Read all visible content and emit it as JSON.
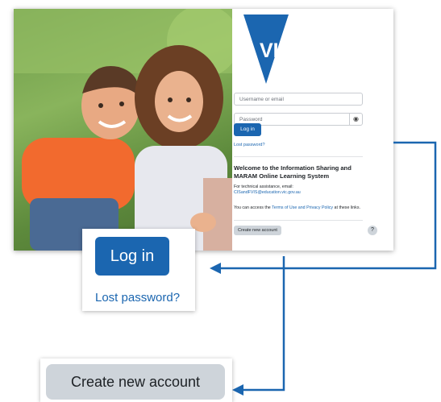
{
  "brand": {
    "logo_text": "VICTORIA",
    "color": "#1b66b0"
  },
  "login": {
    "username_placeholder": "Username or email",
    "password_placeholder": "Password",
    "login_label": "Log in",
    "lost_password": "Lost password?",
    "show_password_icon": "eye-icon"
  },
  "info": {
    "welcome": "Welcome to the Information Sharing and MARAM Online Learning System",
    "assist_prefix": "For technical assistance, email:",
    "assist_email": "CISandFVIS@education.vic.gov.au",
    "terms_prefix": "You can access the ",
    "terms_link": "Terms of Use and Privacy Policy",
    "terms_suffix": " at these links.",
    "create_account": "Create new account",
    "help": "?"
  },
  "callouts": {
    "login_label": "Log in",
    "lost_password": "Lost password?",
    "create_account": "Create new account"
  },
  "colors": {
    "arrow": "#1b66b0",
    "secondary_button": "#ced4da"
  }
}
